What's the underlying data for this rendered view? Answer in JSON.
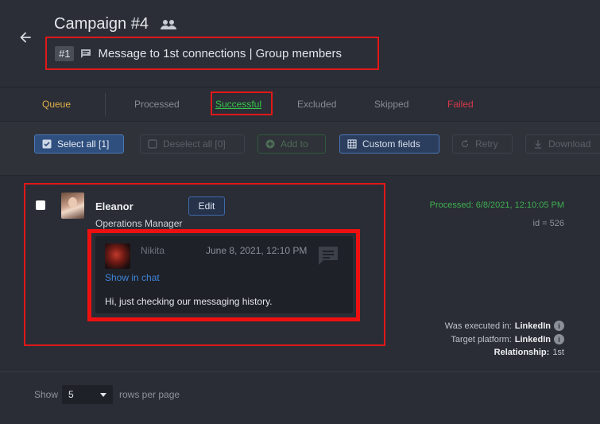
{
  "header": {
    "title": "Campaign #4",
    "step_number": "#1",
    "step_label": "Message to 1st connections | Group members"
  },
  "tabs": [
    {
      "label": "Queue"
    },
    {
      "label": "Processed"
    },
    {
      "label": "Successful"
    },
    {
      "label": "Excluded"
    },
    {
      "label": "Skipped"
    },
    {
      "label": "Failed"
    }
  ],
  "toolbar": {
    "select_all": "Select all [1]",
    "deselect_all": "Deselect all [0]",
    "add_to": "Add to",
    "custom_fields": "Custom fields",
    "retry": "Retry",
    "download": "Download"
  },
  "record": {
    "name": "Eleanor",
    "role": "Operations Manager",
    "edit_label": "Edit",
    "processed": "Processed: 6/8/2021, 12:10:05 PM",
    "id": "id = 526",
    "message": {
      "author": "Nikita",
      "date": "June 8, 2021, 12:10 PM",
      "show_in_chat": "Show in chat",
      "text": "Hi, just checking our messaging history."
    },
    "executed_in_label": "Was executed in:",
    "executed_in_value": "LinkedIn",
    "target_platform_label": "Target platform:",
    "target_platform_value": "LinkedIn",
    "relationship_label": "Relationship:",
    "relationship_value": "1st"
  },
  "footer": {
    "show_label": "Show",
    "rows_value": "5",
    "rows_label": "rows per page"
  },
  "colors": {
    "queue": "#e0b04a",
    "successful": "#36c84a",
    "failed": "#d8384a",
    "link": "#3d84d8",
    "highlight_box": "#e01818"
  }
}
